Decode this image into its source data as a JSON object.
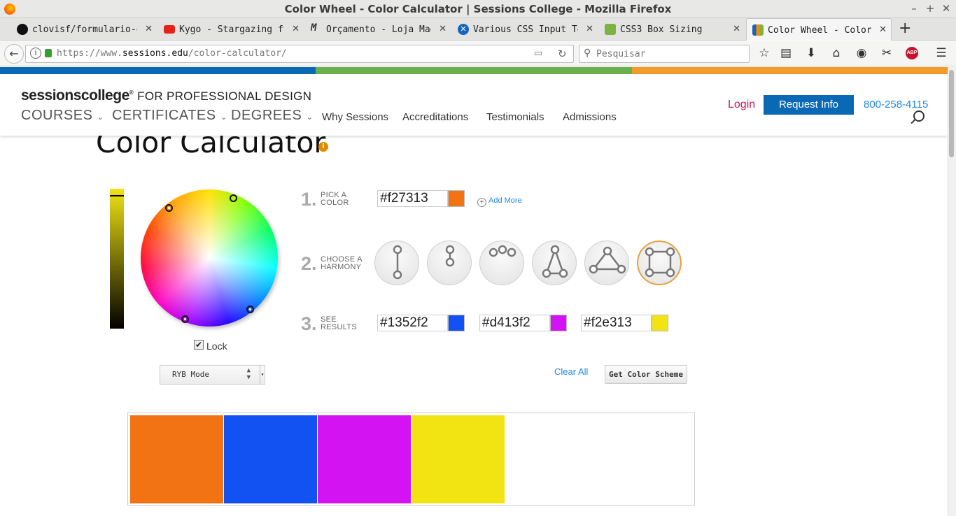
{
  "window": {
    "title": "Color Wheel - Color Calculator | Sessions College - Mozilla Firefox"
  },
  "tabs": [
    {
      "label": "clovisf/formulario-orc",
      "favicon_color": "#111111"
    },
    {
      "label": "Kygo - Stargazing ft.",
      "favicon_color": "#e62117"
    },
    {
      "label": "Orçamento - Loja Maged",
      "favicon_color": "#ffffff"
    },
    {
      "label": "Various CSS Input Text",
      "favicon_color": "#1565c0"
    },
    {
      "label": "CSS3 Box Sizing",
      "favicon_color": "#7cb342"
    },
    {
      "label": "Color Wheel - Color Ca",
      "favicon_color": "#f08c00"
    }
  ],
  "nav": {
    "url_prefix": "https://www.",
    "url_domain": "sessions.edu",
    "url_path": "/color-calculator/",
    "search_placeholder": "Pesquisar"
  },
  "site": {
    "logo": "sessionscollege",
    "logo_tagline": "FOR PROFESSIONAL DESIGN",
    "main_nav": [
      "COURSES",
      "CERTIFICATES",
      "DEGREES"
    ],
    "sub_nav": [
      "Why Sessions",
      "Accreditations",
      "Testimonials",
      "Admissions"
    ],
    "login": "Login",
    "request_info": "Request Info",
    "phone": "800-258-4115",
    "stripe_colors": [
      "#0a69b5",
      "#6ab04c",
      "#f39c2b"
    ]
  },
  "page": {
    "title": "Color Calculator",
    "info_icon": "i"
  },
  "tool": {
    "step1": {
      "number": "1.",
      "label_line1": "PICK A",
      "label_line2": "COLOR",
      "value": "#f27313",
      "swatch": "#f27313",
      "add_more": "Add More"
    },
    "step2": {
      "number": "2.",
      "label_line1": "CHOOSE A",
      "label_line2": "HARMONY",
      "harmonies": [
        "complementary",
        "split-complementary",
        "analogous",
        "triad",
        "triad-wide",
        "tetrad"
      ],
      "selected": "tetrad"
    },
    "step3": {
      "number": "3.",
      "label_line1": "SEE",
      "label_line2": "RESULTS",
      "results": [
        {
          "value": "#1352f2",
          "swatch": "#1352f2"
        },
        {
          "value": "#d413f2",
          "swatch": "#d413f2"
        },
        {
          "value": "#f2e313",
          "swatch": "#f2e313"
        }
      ]
    },
    "lock_label": "Lock",
    "lock_checked": true,
    "mode": "RYB Mode",
    "clear_all": "Clear All",
    "get_scheme": "Get Color Scheme",
    "scheme_colors": [
      "#f27313",
      "#1352f2",
      "#d413f2",
      "#f2e313"
    ]
  }
}
